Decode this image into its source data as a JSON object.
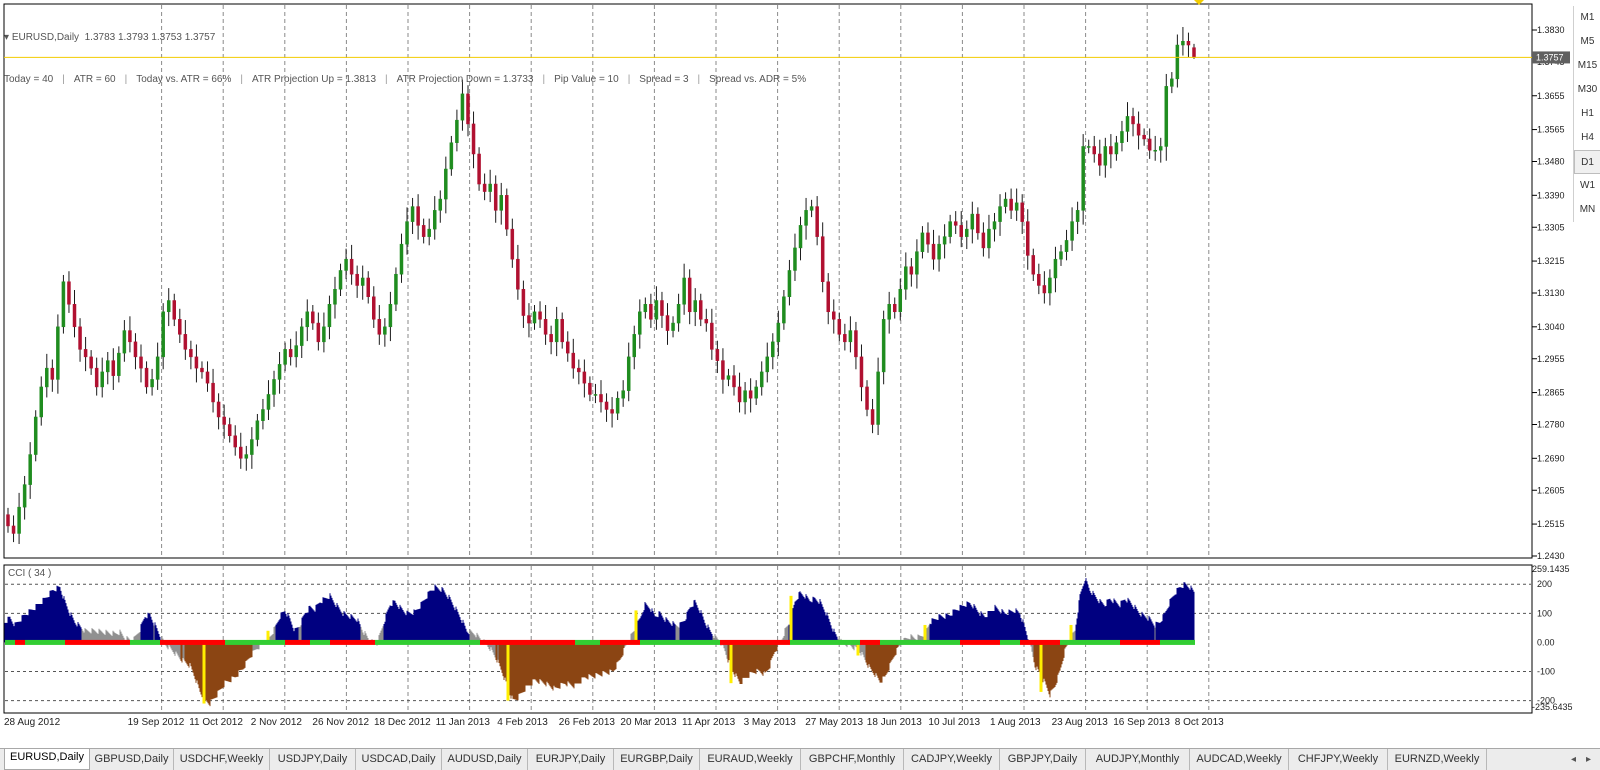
{
  "chart": {
    "header": "EURUSD,Daily  1.3783 1.3793 1.3753 1.3757",
    "info_items": [
      "Today = 40",
      "ATR = 60",
      "Today vs. ATR = 66%",
      "ATR Projection Up = 1.3813",
      "ATR Projection Down = 1.3733",
      "Pip Value = 10",
      "Spread = 3",
      "Spread vs. ADR = 5%"
    ],
    "bid_price": "1.3757",
    "price_labels": [
      "1.3830",
      "1.3745",
      "1.3655",
      "1.3565",
      "1.3480",
      "1.3390",
      "1.3305",
      "1.3215",
      "1.3130",
      "1.3040",
      "1.2955",
      "1.2865",
      "1.2780",
      "1.2690",
      "1.2605",
      "1.2515",
      "1.2430"
    ],
    "date_labels": [
      "28 Aug 2012",
      "19 Sep 2012",
      "11 Oct 2012",
      "2 Nov 2012",
      "26 Nov 2012",
      "18 Dec 2012",
      "11 Jan 2013",
      "4 Feb 2013",
      "26 Feb 2013",
      "20 Mar 2013",
      "11 Apr 2013",
      "3 May 2013",
      "27 May 2013",
      "18 Jun 2013",
      "10 Jul 2013",
      "1 Aug 2013",
      "23 Aug 2013",
      "16 Sep 2013",
      "8 Oct 2013"
    ]
  },
  "indicator": {
    "label": "CCI  ( 34 )",
    "max_label": "259.1435",
    "min_label": "-235.6435",
    "levels": [
      "200",
      "100",
      "0.00",
      "-100",
      "-200"
    ]
  },
  "colors": {
    "bull": "#1f8c1f",
    "bear": "#b01030",
    "wick": "#1a1a1a",
    "grid": "#8a8a8a",
    "bid_line": "#f2cc00",
    "cci_pos": "#000080",
    "cci_neg": "#8b4513",
    "cci_weak": "#909090",
    "cci_signal": "#ffee00",
    "zero_red": "#ff0000",
    "zero_green": "#32cd32"
  },
  "chart_data": {
    "type": "candlestick",
    "symbol": "EURUSD",
    "timeframe": "Daily",
    "last_bar": {
      "open": 1.3783,
      "high": 1.3793,
      "low": 1.3753,
      "close": 1.3757
    },
    "ylim": [
      1.243,
      1.383
    ],
    "closes": [
      1.251,
      1.249,
      1.256,
      1.262,
      1.27,
      1.28,
      1.288,
      1.293,
      1.29,
      1.304,
      1.316,
      1.31,
      1.304,
      1.298,
      1.296,
      1.293,
      1.288,
      1.292,
      1.295,
      1.291,
      1.297,
      1.303,
      1.3,
      1.296,
      1.293,
      1.288,
      1.29,
      1.296,
      1.308,
      1.311,
      1.306,
      1.302,
      1.298,
      1.296,
      1.293,
      1.292,
      1.289,
      1.284,
      1.28,
      1.278,
      1.275,
      1.272,
      1.269,
      1.27,
      1.274,
      1.279,
      1.282,
      1.286,
      1.29,
      1.294,
      1.298,
      1.296,
      1.299,
      1.304,
      1.308,
      1.305,
      1.3,
      1.304,
      1.31,
      1.314,
      1.319,
      1.322,
      1.318,
      1.315,
      1.317,
      1.312,
      1.306,
      1.302,
      1.304,
      1.31,
      1.318,
      1.326,
      1.332,
      1.336,
      1.331,
      1.328,
      1.33,
      1.335,
      1.338,
      1.346,
      1.353,
      1.359,
      1.366,
      1.358,
      1.35,
      1.342,
      1.34,
      1.342,
      1.335,
      1.339,
      1.33,
      1.322,
      1.314,
      1.307,
      1.305,
      1.308,
      1.306,
      1.302,
      1.3,
      1.306,
      1.3,
      1.297,
      1.293,
      1.292,
      1.289,
      1.286,
      1.286,
      1.284,
      1.282,
      1.281,
      1.285,
      1.287,
      1.296,
      1.302,
      1.308,
      1.31,
      1.306,
      1.311,
      1.307,
      1.303,
      1.305,
      1.31,
      1.317,
      1.308,
      1.311,
      1.306,
      1.305,
      1.298,
      1.295,
      1.29,
      1.291,
      1.288,
      1.284,
      1.287,
      1.285,
      1.288,
      1.292,
      1.296,
      1.3,
      1.305,
      1.312,
      1.319,
      1.325,
      1.331,
      1.335,
      1.336,
      1.328,
      1.316,
      1.308,
      1.306,
      1.302,
      1.3,
      1.303,
      1.296,
      1.288,
      1.282,
      1.278,
      1.292,
      1.306,
      1.31,
      1.308,
      1.314,
      1.32,
      1.318,
      1.324,
      1.329,
      1.326,
      1.322,
      1.326,
      1.328,
      1.332,
      1.331,
      1.328,
      1.33,
      1.334,
      1.329,
      1.325,
      1.33,
      1.332,
      1.336,
      1.338,
      1.335,
      1.337,
      1.332,
      1.323,
      1.318,
      1.315,
      1.313,
      1.317,
      1.322,
      1.324,
      1.327,
      1.332,
      1.335,
      1.352,
      1.352,
      1.35,
      1.347,
      1.352,
      1.35,
      1.353,
      1.356,
      1.36,
      1.358,
      1.355,
      1.354,
      1.351,
      1.351,
      1.352,
      1.368,
      1.37,
      1.379,
      1.38,
      1.379,
      1.3757
    ],
    "cci": [
      [
        0,
        70
      ],
      [
        5,
        85
      ],
      [
        10,
        60
      ],
      [
        20,
        95
      ],
      [
        30,
        120
      ],
      [
        40,
        150
      ],
      [
        48,
        180
      ],
      [
        55,
        190
      ],
      [
        60,
        140
      ],
      [
        65,
        100
      ],
      [
        70,
        70
      ],
      [
        80,
        40
      ],
      [
        90,
        40
      ],
      [
        100,
        35
      ],
      [
        110,
        30
      ],
      [
        115,
        35
      ],
      [
        120,
        15
      ],
      [
        128,
        5
      ],
      [
        135,
        45
      ],
      [
        140,
        90
      ],
      [
        145,
        95
      ],
      [
        150,
        60
      ],
      [
        155,
        25
      ],
      [
        160,
        -5
      ],
      [
        168,
        -30
      ],
      [
        175,
        -55
      ],
      [
        185,
        -80
      ],
      [
        190,
        -120
      ],
      [
        195,
        -170
      ],
      [
        200,
        -200
      ],
      [
        205,
        -210
      ],
      [
        212,
        -180
      ],
      [
        220,
        -140
      ],
      [
        230,
        -120
      ],
      [
        238,
        -90
      ],
      [
        245,
        -50
      ],
      [
        252,
        -20
      ],
      [
        258,
        -5
      ],
      [
        265,
        20
      ],
      [
        270,
        50
      ],
      [
        275,
        90
      ],
      [
        280,
        110
      ],
      [
        285,
        80
      ],
      [
        290,
        40
      ],
      [
        295,
        60
      ],
      [
        300,
        100
      ],
      [
        305,
        120
      ],
      [
        310,
        115
      ],
      [
        315,
        140
      ],
      [
        320,
        150
      ],
      [
        325,
        160
      ],
      [
        330,
        135
      ],
      [
        338,
        100
      ],
      [
        345,
        90
      ],
      [
        352,
        80
      ],
      [
        358,
        40
      ],
      [
        365,
        5
      ],
      [
        372,
        -5
      ],
      [
        380,
        80
      ],
      [
        385,
        130
      ],
      [
        390,
        140
      ],
      [
        395,
        120
      ],
      [
        402,
        100
      ],
      [
        410,
        105
      ],
      [
        415,
        125
      ],
      [
        420,
        150
      ],
      [
        425,
        175
      ],
      [
        430,
        190
      ],
      [
        438,
        180
      ],
      [
        445,
        150
      ],
      [
        450,
        120
      ],
      [
        455,
        90
      ],
      [
        462,
        40
      ],
      [
        470,
        30
      ],
      [
        478,
        5
      ],
      [
        485,
        -20
      ],
      [
        492,
        -60
      ],
      [
        498,
        -110
      ],
      [
        503,
        -160
      ],
      [
        508,
        -200
      ],
      [
        513,
        -190
      ],
      [
        520,
        -160
      ],
      [
        530,
        -130
      ],
      [
        540,
        -140
      ],
      [
        550,
        -160
      ],
      [
        560,
        -140
      ],
      [
        570,
        -150
      ],
      [
        580,
        -120
      ],
      [
        590,
        -115
      ],
      [
        600,
        -105
      ],
      [
        608,
        -100
      ],
      [
        615,
        -60
      ],
      [
        620,
        -20
      ],
      [
        625,
        15
      ],
      [
        630,
        45
      ],
      [
        635,
        80
      ],
      [
        640,
        130
      ],
      [
        645,
        120
      ],
      [
        650,
        90
      ],
      [
        655,
        100
      ],
      [
        660,
        80
      ],
      [
        665,
        70
      ],
      [
        670,
        60
      ],
      [
        675,
        60
      ],
      [
        680,
        80
      ],
      [
        685,
        120
      ],
      [
        690,
        140
      ],
      [
        695,
        110
      ],
      [
        700,
        70
      ],
      [
        705,
        40
      ],
      [
        710,
        20
      ],
      [
        715,
        5
      ],
      [
        720,
        -30
      ],
      [
        725,
        -80
      ],
      [
        730,
        -110
      ],
      [
        735,
        -140
      ],
      [
        740,
        -125
      ],
      [
        745,
        -110
      ],
      [
        750,
        -100
      ],
      [
        755,
        -100
      ],
      [
        760,
        -110
      ],
      [
        765,
        -80
      ],
      [
        770,
        -30
      ],
      [
        775,
        -5
      ],
      [
        780,
        40
      ],
      [
        785,
        70
      ],
      [
        790,
        140
      ],
      [
        795,
        170
      ],
      [
        800,
        160
      ],
      [
        805,
        145
      ],
      [
        810,
        150
      ],
      [
        815,
        140
      ],
      [
        820,
        110
      ],
      [
        825,
        70
      ],
      [
        830,
        30
      ],
      [
        835,
        5
      ],
      [
        840,
        -5
      ],
      [
        845,
        -10
      ],
      [
        850,
        -20
      ],
      [
        855,
        -30
      ],
      [
        860,
        -60
      ],
      [
        865,
        -90
      ],
      [
        870,
        -110
      ],
      [
        875,
        -135
      ],
      [
        880,
        -120
      ],
      [
        885,
        -80
      ],
      [
        890,
        -40
      ],
      [
        895,
        -10
      ],
      [
        900,
        10
      ],
      [
        905,
        20
      ],
      [
        910,
        15
      ],
      [
        915,
        20
      ],
      [
        920,
        30
      ],
      [
        925,
        70
      ],
      [
        930,
        80
      ],
      [
        935,
        90
      ],
      [
        940,
        90
      ],
      [
        945,
        95
      ],
      [
        950,
        110
      ],
      [
        955,
        120
      ],
      [
        960,
        130
      ],
      [
        965,
        135
      ],
      [
        970,
        120
      ],
      [
        975,
        100
      ],
      [
        980,
        90
      ],
      [
        985,
        105
      ],
      [
        990,
        120
      ],
      [
        995,
        110
      ],
      [
        1000,
        100
      ],
      [
        1005,
        105
      ],
      [
        1010,
        110
      ],
      [
        1015,
        100
      ],
      [
        1020,
        50
      ],
      [
        1025,
        -5
      ],
      [
        1030,
        -80
      ],
      [
        1035,
        -110
      ],
      [
        1040,
        -140
      ],
      [
        1045,
        -180
      ],
      [
        1050,
        -150
      ],
      [
        1055,
        -100
      ],
      [
        1060,
        -30
      ],
      [
        1065,
        10
      ],
      [
        1070,
        40
      ],
      [
        1075,
        160
      ],
      [
        1080,
        220
      ],
      [
        1085,
        180
      ],
      [
        1090,
        160
      ],
      [
        1095,
        140
      ],
      [
        1100,
        130
      ],
      [
        1105,
        150
      ],
      [
        1110,
        140
      ],
      [
        1115,
        130
      ],
      [
        1120,
        150
      ],
      [
        1125,
        140
      ],
      [
        1130,
        120
      ],
      [
        1135,
        100
      ],
      [
        1140,
        90
      ],
      [
        1145,
        80
      ],
      [
        1150,
        60
      ],
      [
        1155,
        70
      ],
      [
        1160,
        100
      ],
      [
        1165,
        140
      ],
      [
        1170,
        170
      ],
      [
        1175,
        190
      ],
      [
        1180,
        200
      ],
      [
        1185,
        190
      ],
      [
        1190,
        170
      ],
      [
        1195,
        140
      ]
    ]
  },
  "tabs": [
    "EURUSD,Daily",
    "GBPUSD,Daily",
    "USDCHF,Weekly",
    "USDJPY,Daily",
    "USDCAD,Daily",
    "AUDUSD,Daily",
    "EURJPY,Daily",
    "EURGBP,Daily",
    "EURAUD,Weekly",
    "GBPCHF,Monthly",
    "CADJPY,Weekly",
    "GBPJPY,Daily",
    "AUDJPY,Monthly",
    "AUDCAD,Weekly",
    "CHFJPY,Weekly",
    "EURNZD,Weekly"
  ],
  "active_tab": 0,
  "timeframes": [
    "M1",
    "M5",
    "M15",
    "M30",
    "H1",
    "H4",
    "D1",
    "W1",
    "MN"
  ],
  "active_timeframe": "D1",
  "scroll_icons": [
    "left-arrow-icon",
    "right-arrow-icon"
  ]
}
